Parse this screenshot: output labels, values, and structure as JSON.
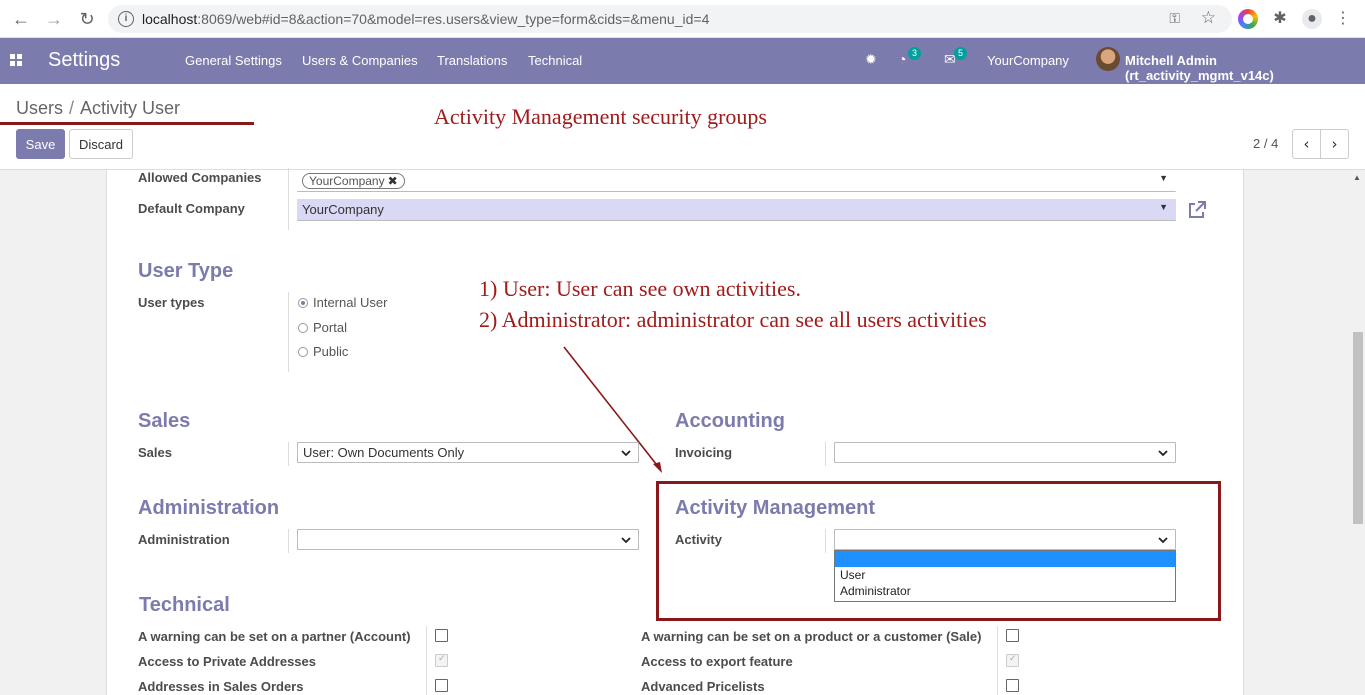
{
  "browser": {
    "url_host": "localhost",
    "url_rest": ":8069/web#id=8&action=70&model=res.users&view_type=form&cids=&menu_id=4"
  },
  "navbar": {
    "brand": "Settings",
    "menus": [
      "General Settings",
      "Users & Companies",
      "Translations",
      "Technical"
    ],
    "activity_badge": "3",
    "messages_badge": "5",
    "company": "YourCompany",
    "user": "Mitchell Admin (rt_activity_mgmt_v14c)"
  },
  "control": {
    "breadcrumb_parent": "Users",
    "breadcrumb_sep": "/",
    "breadcrumb_current": "Activity User",
    "save_label": "Save",
    "discard_label": "Discard",
    "pager": "2 / 4"
  },
  "annotations": {
    "title": "Activity Management security groups",
    "line1": "1) User: User can see own activities.",
    "line2": "2) Administrator: administrator can see all users activities"
  },
  "form": {
    "allowed_companies_label": "Allowed Companies",
    "allowed_companies_tag": "YourCompany",
    "default_company_label": "Default Company",
    "default_company_value": "YourCompany",
    "user_type_section": "User Type",
    "user_types_label": "User types",
    "user_type_options": [
      "Internal User",
      "Portal",
      "Public"
    ],
    "user_type_selected": "Internal User",
    "sales_section": "Sales",
    "sales_label": "Sales",
    "sales_value": "User: Own Documents Only",
    "accounting_section": "Accounting",
    "invoicing_label": "Invoicing",
    "invoicing_value": "",
    "administration_section": "Administration",
    "administration_label": "Administration",
    "administration_value": "",
    "activity_section": "Activity Management",
    "activity_label": "Activity",
    "activity_value": "",
    "activity_options": [
      "",
      "User",
      "Administrator"
    ],
    "technical_section": "Technical",
    "technical_left": [
      {
        "label": "A warning can be set on a partner (Account)",
        "checked": false,
        "readonly": false
      },
      {
        "label": "Access to Private Addresses",
        "checked": true,
        "readonly": true
      },
      {
        "label": "Addresses in Sales Orders",
        "checked": false,
        "readonly": false
      }
    ],
    "technical_right": [
      {
        "label": "A warning can be set on a product or a customer (Sale)",
        "checked": false,
        "readonly": false
      },
      {
        "label": "Access to export feature",
        "checked": true,
        "readonly": true
      },
      {
        "label": "Advanced Pricelists",
        "checked": false,
        "readonly": false
      }
    ]
  },
  "colors": {
    "brand": "#7c7bad",
    "annotation": "#a11b1b",
    "highlight_field": "#d9d8f5"
  }
}
